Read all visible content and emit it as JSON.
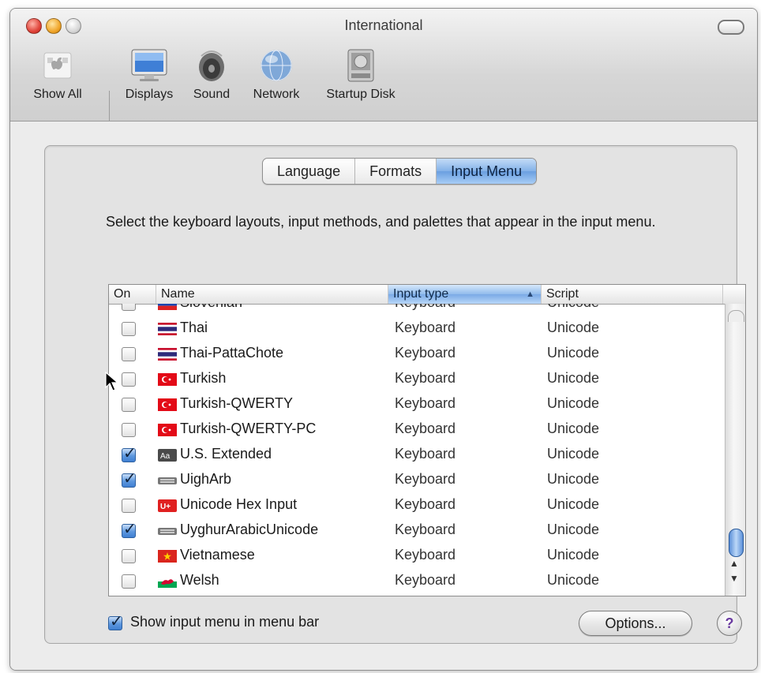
{
  "window": {
    "title": "International"
  },
  "toolbar": {
    "items": [
      {
        "label": "Show All",
        "icon": "apple-grid-icon"
      },
      {
        "label": "Displays",
        "icon": "display-icon"
      },
      {
        "label": "Sound",
        "icon": "speaker-icon"
      },
      {
        "label": "Network",
        "icon": "network-globe-icon"
      },
      {
        "label": "Startup Disk",
        "icon": "hard-disk-icon"
      }
    ]
  },
  "tabs": [
    {
      "label": "Language",
      "selected": false
    },
    {
      "label": "Formats",
      "selected": false
    },
    {
      "label": "Input Menu",
      "selected": true
    }
  ],
  "description": "Select the keyboard layouts, input methods, and palettes that appear in the input menu.",
  "table": {
    "columns": {
      "on": "On",
      "name": "Name",
      "type": "Input type",
      "script": "Script"
    },
    "sort_column": "Input type",
    "rows": [
      {
        "on": false,
        "name": "Slovenian",
        "type": "Keyboard",
        "script": "Unicode",
        "flag": "slovenia-flag-icon"
      },
      {
        "on": false,
        "name": "Thai",
        "type": "Keyboard",
        "script": "Unicode",
        "flag": "thailand-flag-icon"
      },
      {
        "on": false,
        "name": "Thai-PattaChote",
        "type": "Keyboard",
        "script": "Unicode",
        "flag": "thailand-flag-icon"
      },
      {
        "on": false,
        "name": "Turkish",
        "type": "Keyboard",
        "script": "Unicode",
        "flag": "turkey-flag-icon"
      },
      {
        "on": false,
        "name": "Turkish-QWERTY",
        "type": "Keyboard",
        "script": "Unicode",
        "flag": "turkey-flag-icon"
      },
      {
        "on": false,
        "name": "Turkish-QWERTY-PC",
        "type": "Keyboard",
        "script": "Unicode",
        "flag": "turkey-flag-icon"
      },
      {
        "on": true,
        "name": "U.S. Extended",
        "type": "Keyboard",
        "script": "Unicode",
        "flag": "us-extended-icon"
      },
      {
        "on": true,
        "name": "UighArb",
        "type": "Keyboard",
        "script": "Unicode",
        "flag": "keyboard-icon"
      },
      {
        "on": false,
        "name": "Unicode Hex Input",
        "type": "Keyboard",
        "script": "Unicode",
        "flag": "unicode-hex-icon"
      },
      {
        "on": true,
        "name": "UyghurArabicUnicode",
        "type": "Keyboard",
        "script": "Unicode",
        "flag": "keyboard-icon"
      },
      {
        "on": false,
        "name": "Vietnamese",
        "type": "Keyboard",
        "script": "Unicode",
        "flag": "vietnam-flag-icon"
      },
      {
        "on": false,
        "name": "Welsh",
        "type": "Keyboard",
        "script": "Unicode",
        "flag": "wales-flag-icon"
      }
    ]
  },
  "show_input_menu": {
    "checked": true,
    "label": "Show input menu in menu bar"
  },
  "buttons": {
    "options": "Options...",
    "help": "?"
  },
  "colors": {
    "accent": "#6a9fe0",
    "window_bg": "#ececec"
  }
}
